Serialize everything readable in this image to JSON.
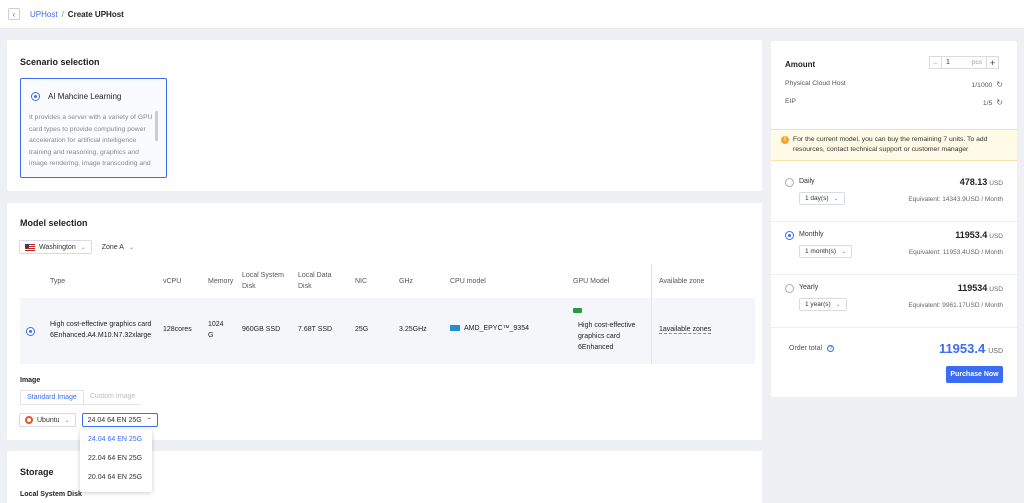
{
  "breadcrumb": {
    "parent": "UPHost",
    "separator": "/",
    "current": "Create UPHost"
  },
  "scenario": {
    "title": "Scenario selection",
    "option": {
      "label": "AI Mahcine Learning",
      "description": "It provides a server with a variety of GPU card types to provide computing power acceleration for artificial intelligence training and reasoning, graphics and image rendering, image transcoding and"
    }
  },
  "model": {
    "title": "Model selection",
    "region": "Washington",
    "zone": "Zone A",
    "columns": {
      "type": "Type",
      "vcpu": "vCPU",
      "memory": "Memory",
      "local_system_disk": "Local System Disk",
      "local_data_disk": "Local Data Disk",
      "nic": "NIC",
      "ghz": "GHz",
      "cpu_model": "CPU model",
      "gpu_model": "GPU Model",
      "available_zone": "Available zone"
    },
    "row": {
      "type_line1": "High cost-effective graphics card",
      "type_line2": "6Enhanced.A4.M10.N7.32xlarge",
      "vcpu": "128cores",
      "memory": "1024 G",
      "local_system_disk": "960GB SSD",
      "local_data_disk": "7.68T SSD",
      "nic": "25G",
      "ghz": "3.25GHz",
      "cpu_model": "AMD_EPYC™_9354",
      "gpu_model": "High cost-effective graphics card 6Enhanced",
      "available_zone": "1available zones"
    }
  },
  "image": {
    "label": "Image",
    "tabs": [
      "Standard Image",
      "Custom Image"
    ],
    "os": "Ubuntu",
    "version": "24.04 64 EN 25G",
    "version_options": [
      "24.04 64 EN 25G",
      "22.04 64 EN 25G",
      "20.04 64 EN 25G"
    ]
  },
  "storage": {
    "title": "Storage",
    "local_system_disk": "Local System Disk"
  },
  "side": {
    "amount_label": "Amount",
    "amount_value": "1",
    "amount_unit": "pcs",
    "physical_cloud_host_label": "Physical Cloud Host",
    "physical_cloud_host_quota": "1/1000",
    "eip_label": "EIP",
    "eip_quota": "1/5",
    "notice": "For the current model, you can buy the remaining 7 units. To add resources, contact technical support or customer manager",
    "plans": [
      {
        "name": "Daily",
        "price": "478.13",
        "currency": "USD",
        "duration": "1 day(s)",
        "equivalent": "Equivalent: 14343.9USD / Month"
      },
      {
        "name": "Monthly",
        "price": "11953.4",
        "currency": "USD",
        "duration": "1 month(s)",
        "equivalent": "Equivalent: 11953.4USD / Month"
      },
      {
        "name": "Yearly",
        "price": "119534",
        "currency": "USD",
        "duration": "1 year(s)",
        "equivalent": "Equivalent: 9961.17USD / Month"
      }
    ],
    "order_total_label": "Order total",
    "order_total": "11953.4",
    "order_currency": "USD",
    "purchase_label": "Purchase Now"
  },
  "colors": {
    "accent": "#3a6cf4",
    "warning": "#f5a623"
  }
}
